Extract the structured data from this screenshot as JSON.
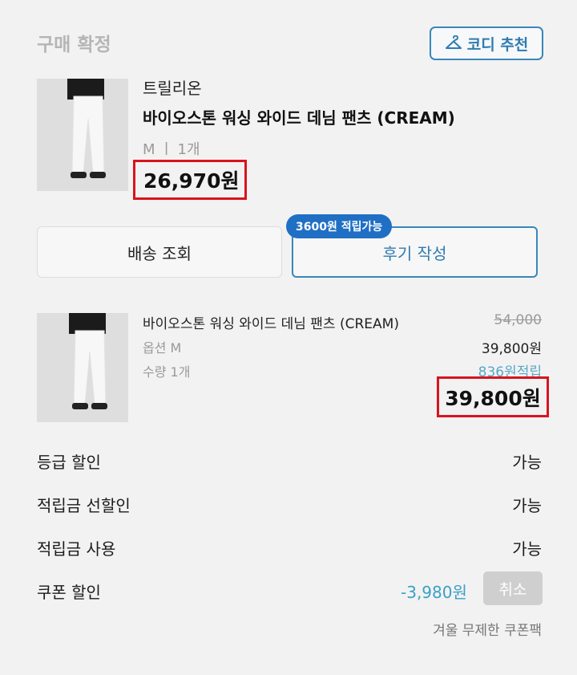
{
  "header": {
    "status": "구매 확정",
    "codi_button": "코디 추천"
  },
  "product": {
    "brand": "트릴리온",
    "name": "바이오스톤 워싱 와이드 데님 팬츠 (CREAM)",
    "option_summary": "M ㅣ 1개",
    "price": "26,970원"
  },
  "actions": {
    "shipping_label": "배송 조회",
    "review_label": "후기 작성",
    "review_badge": "3600원 적립가능"
  },
  "order_item": {
    "name": "바이오스톤 워싱 와이드 데님 팬츠 (CREAM)",
    "option": "옵션 M",
    "quantity": "수량 1개",
    "original_price": "54,000",
    "sale_price": "39,800원",
    "points": "836원적립",
    "final_price": "39,800원"
  },
  "discounts": [
    {
      "label": "등급 할인",
      "value": "가능"
    },
    {
      "label": "적립금 선할인",
      "value": "가능"
    },
    {
      "label": "적립금 사용",
      "value": "가능"
    }
  ],
  "coupon": {
    "label": "쿠폰 할인",
    "amount": "-3,980원",
    "cancel_label": "취소",
    "coupon_name": "겨울 무제한 쿠폰팩"
  },
  "colors": {
    "accent": "#3b86b8",
    "badge": "#1f6fc4",
    "highlight_box": "#d8141f",
    "points_text": "#58a8c7"
  }
}
